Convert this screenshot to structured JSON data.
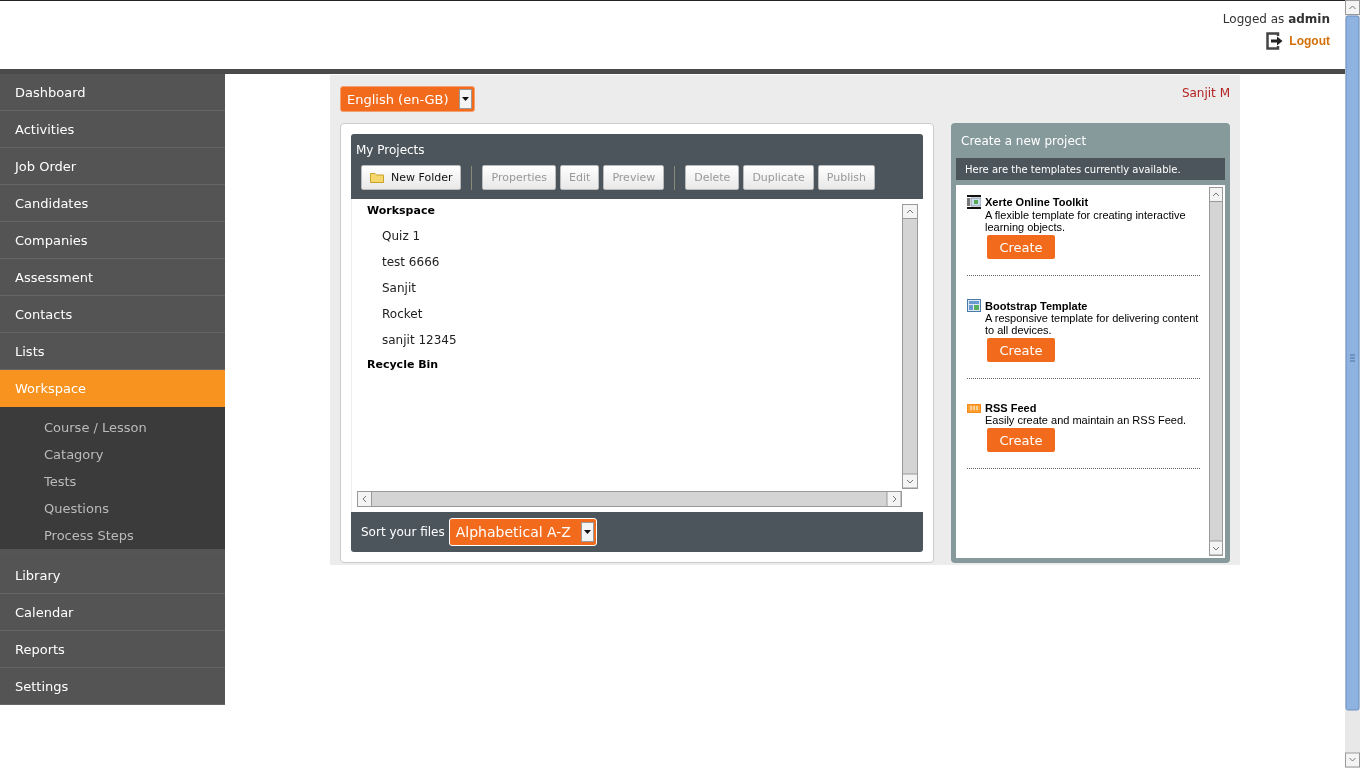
{
  "header": {
    "logged_as": "Logged as **admin**",
    "logout": "Logout"
  },
  "sidebar": {
    "items": [
      {
        "label": "Dashboard",
        "selected": false
      },
      {
        "label": "Activities",
        "selected": false
      },
      {
        "label": "Job Order",
        "selected": false
      },
      {
        "label": "Candidates",
        "selected": false
      },
      {
        "label": "Companies",
        "selected": false
      },
      {
        "label": "Assessment",
        "selected": false
      },
      {
        "label": "Contacts",
        "selected": false
      },
      {
        "label": "Lists",
        "selected": false
      },
      {
        "label": "Workspace",
        "selected": true,
        "expanded": true,
        "children": [
          {
            "label": "Course / Lesson"
          },
          {
            "label": "Catagory"
          },
          {
            "label": "Tests"
          },
          {
            "label": "Questions"
          },
          {
            "label": "Process Steps"
          }
        ]
      },
      {
        "label": "Library",
        "selected": false
      },
      {
        "label": "Calendar",
        "selected": false
      },
      {
        "label": "Reports",
        "selected": false
      },
      {
        "label": "Settings",
        "selected": false
      }
    ]
  },
  "language": {
    "value": "English (en-GB)"
  },
  "user": "Sanjit M",
  "projects": {
    "title": "My Projects",
    "toolbar": [
      [
        {
          "label": "New Folder",
          "disabled": false,
          "kind": "folder"
        }
      ],
      [
        {
          "label": "Properties",
          "disabled": true,
          "kind": "plain"
        },
        {
          "label": "Edit",
          "disabled": true,
          "kind": "plain"
        },
        {
          "label": "Preview",
          "disabled": true,
          "kind": "plain"
        }
      ],
      [
        {
          "label": "Delete",
          "disabled": true,
          "kind": "plain"
        },
        {
          "label": "Duplicate",
          "disabled": true,
          "kind": "plain"
        },
        {
          "label": "Publish",
          "disabled": true,
          "kind": "plain"
        }
      ]
    ],
    "tree": [
      {
        "label": "Workspace",
        "children": [
          {
            "label": "Quiz 1"
          },
          {
            "label": "test 6666"
          },
          {
            "label": "Sanjit"
          },
          {
            "label": "Rocket"
          },
          {
            "label": "sanjit 12345"
          }
        ]
      },
      {
        "label": "Recycle Bin"
      }
    ],
    "sort_label": "Sort your files",
    "sort_value": "Alphabetical A-Z"
  },
  "create": {
    "title": "Create a new project",
    "subtitle": "Here are the templates currently available.",
    "templates": [
      {
        "kind": "toolkit",
        "name": "Xerte Online Toolkit",
        "description": "A flexible template for creating interactive learning objects.",
        "button": "Create"
      },
      {
        "kind": "layout",
        "name": "Bootstrap Template",
        "description": "A responsive template for delivering content to all devices.",
        "button": "Create"
      },
      {
        "kind": "rss",
        "name": "RSS Feed",
        "description": "Easily create and maintain an RSS Feed.",
        "button": "Create"
      }
    ]
  }
}
